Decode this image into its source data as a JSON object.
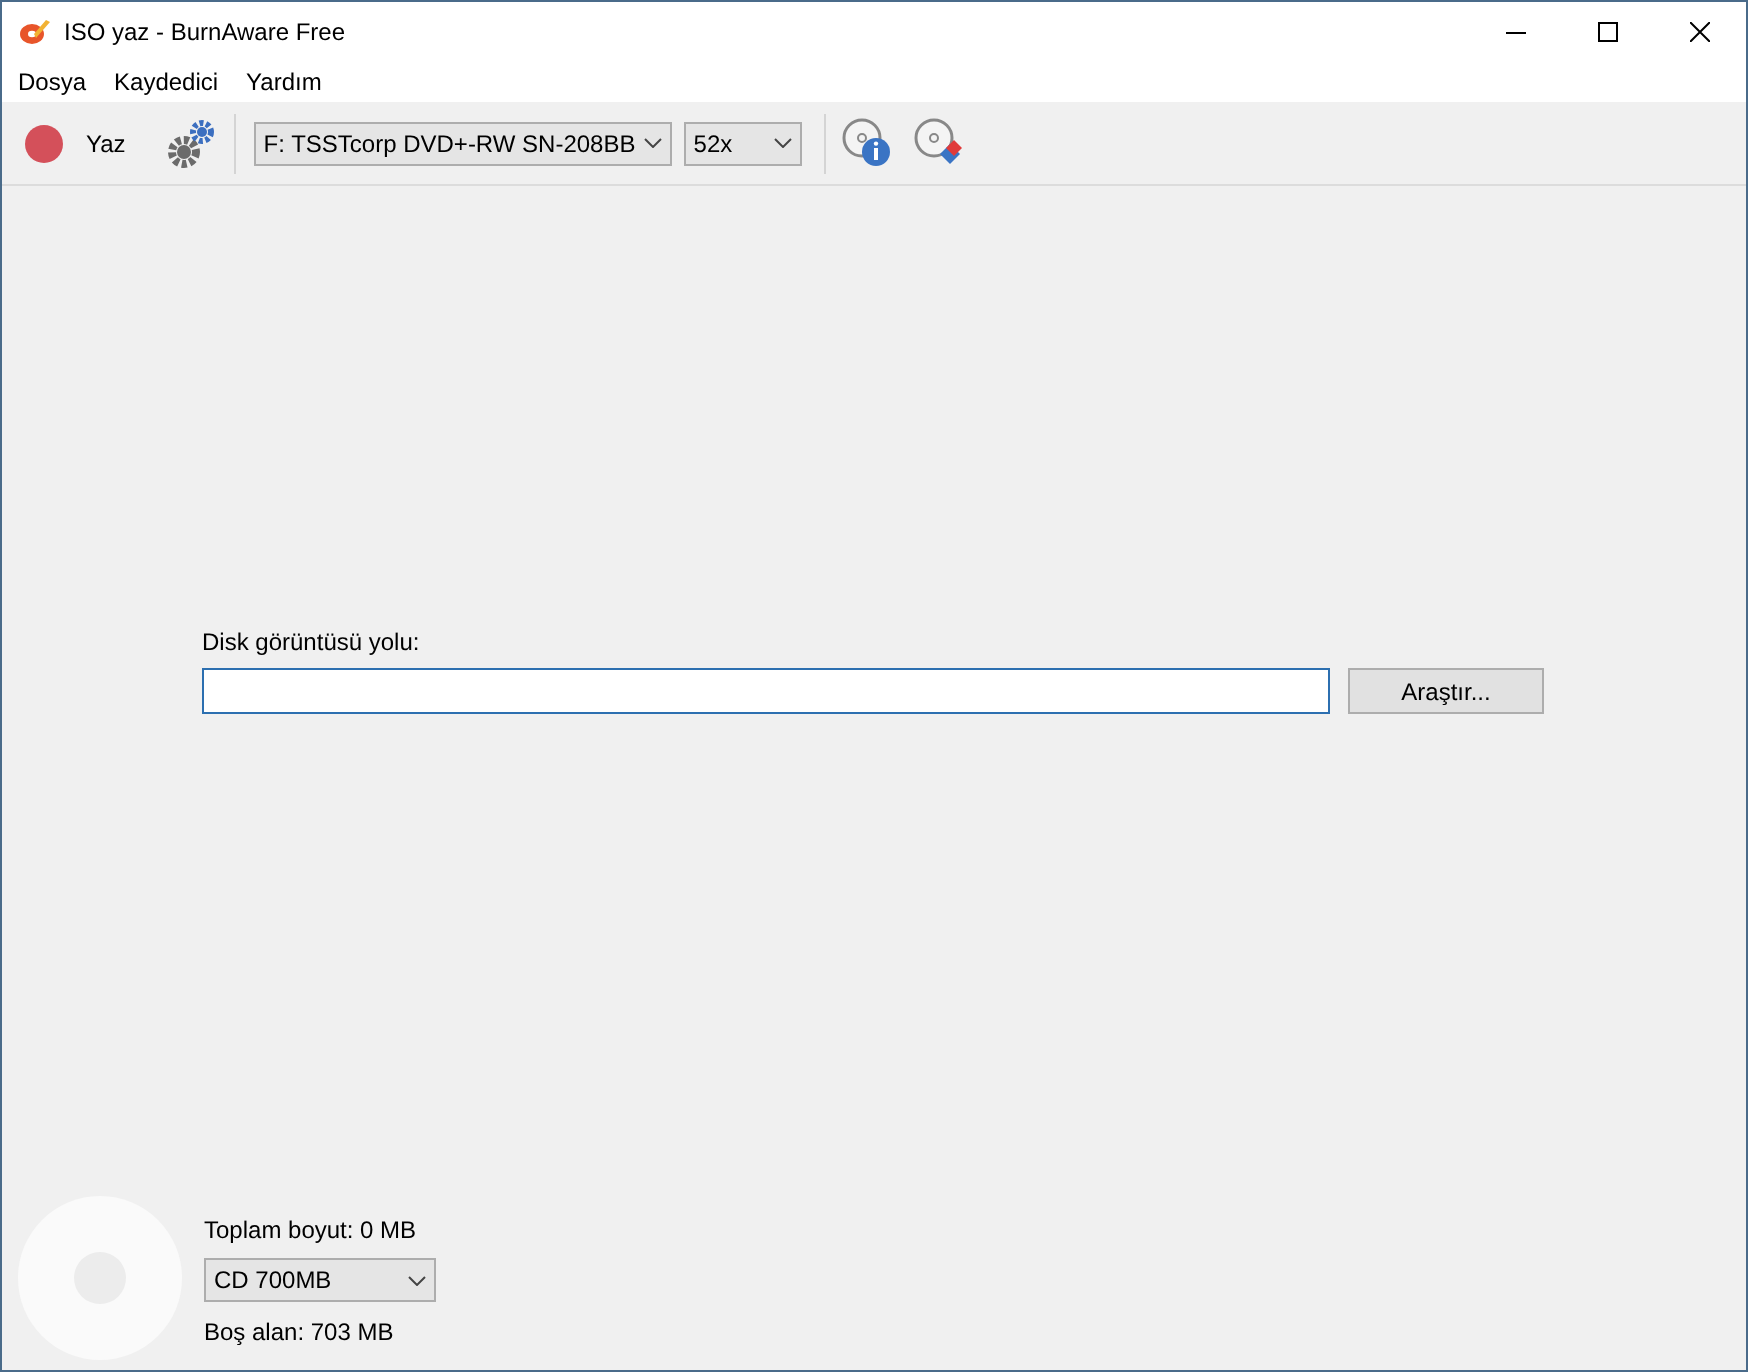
{
  "window": {
    "title": "ISO yaz - BurnAware Free"
  },
  "menu": [
    "Dosya",
    "Kaydedici",
    "Yardım"
  ],
  "toolbar": {
    "burn_label": "Yaz",
    "drive": "F: TSSTcorp DVD+-RW SN-208BB",
    "speed": "52x"
  },
  "image_path": {
    "label": "Disk görüntüsü yolu:",
    "browse": "Araştır..."
  },
  "footer": {
    "total_size": "Toplam boyut: 0 MB",
    "disc_type": "CD 700MB",
    "free_space": "Boş alan: 703 MB"
  }
}
